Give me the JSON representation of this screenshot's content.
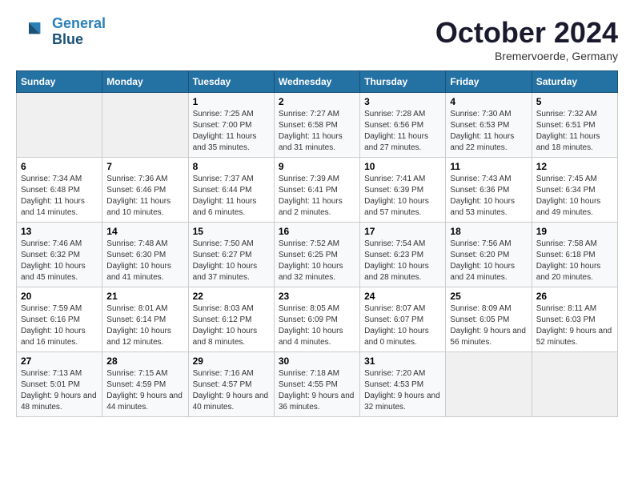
{
  "header": {
    "logo_line1": "General",
    "logo_line2": "Blue",
    "month": "October 2024",
    "location": "Bremervoerde, Germany"
  },
  "days_of_week": [
    "Sunday",
    "Monday",
    "Tuesday",
    "Wednesday",
    "Thursday",
    "Friday",
    "Saturday"
  ],
  "weeks": [
    [
      {
        "day": "",
        "sunrise": "",
        "sunset": "",
        "daylight": ""
      },
      {
        "day": "",
        "sunrise": "",
        "sunset": "",
        "daylight": ""
      },
      {
        "day": "1",
        "sunrise": "Sunrise: 7:25 AM",
        "sunset": "Sunset: 7:00 PM",
        "daylight": "Daylight: 11 hours and 35 minutes."
      },
      {
        "day": "2",
        "sunrise": "Sunrise: 7:27 AM",
        "sunset": "Sunset: 6:58 PM",
        "daylight": "Daylight: 11 hours and 31 minutes."
      },
      {
        "day": "3",
        "sunrise": "Sunrise: 7:28 AM",
        "sunset": "Sunset: 6:56 PM",
        "daylight": "Daylight: 11 hours and 27 minutes."
      },
      {
        "day": "4",
        "sunrise": "Sunrise: 7:30 AM",
        "sunset": "Sunset: 6:53 PM",
        "daylight": "Daylight: 11 hours and 22 minutes."
      },
      {
        "day": "5",
        "sunrise": "Sunrise: 7:32 AM",
        "sunset": "Sunset: 6:51 PM",
        "daylight": "Daylight: 11 hours and 18 minutes."
      }
    ],
    [
      {
        "day": "6",
        "sunrise": "Sunrise: 7:34 AM",
        "sunset": "Sunset: 6:48 PM",
        "daylight": "Daylight: 11 hours and 14 minutes."
      },
      {
        "day": "7",
        "sunrise": "Sunrise: 7:36 AM",
        "sunset": "Sunset: 6:46 PM",
        "daylight": "Daylight: 11 hours and 10 minutes."
      },
      {
        "day": "8",
        "sunrise": "Sunrise: 7:37 AM",
        "sunset": "Sunset: 6:44 PM",
        "daylight": "Daylight: 11 hours and 6 minutes."
      },
      {
        "day": "9",
        "sunrise": "Sunrise: 7:39 AM",
        "sunset": "Sunset: 6:41 PM",
        "daylight": "Daylight: 11 hours and 2 minutes."
      },
      {
        "day": "10",
        "sunrise": "Sunrise: 7:41 AM",
        "sunset": "Sunset: 6:39 PM",
        "daylight": "Daylight: 10 hours and 57 minutes."
      },
      {
        "day": "11",
        "sunrise": "Sunrise: 7:43 AM",
        "sunset": "Sunset: 6:36 PM",
        "daylight": "Daylight: 10 hours and 53 minutes."
      },
      {
        "day": "12",
        "sunrise": "Sunrise: 7:45 AM",
        "sunset": "Sunset: 6:34 PM",
        "daylight": "Daylight: 10 hours and 49 minutes."
      }
    ],
    [
      {
        "day": "13",
        "sunrise": "Sunrise: 7:46 AM",
        "sunset": "Sunset: 6:32 PM",
        "daylight": "Daylight: 10 hours and 45 minutes."
      },
      {
        "day": "14",
        "sunrise": "Sunrise: 7:48 AM",
        "sunset": "Sunset: 6:30 PM",
        "daylight": "Daylight: 10 hours and 41 minutes."
      },
      {
        "day": "15",
        "sunrise": "Sunrise: 7:50 AM",
        "sunset": "Sunset: 6:27 PM",
        "daylight": "Daylight: 10 hours and 37 minutes."
      },
      {
        "day": "16",
        "sunrise": "Sunrise: 7:52 AM",
        "sunset": "Sunset: 6:25 PM",
        "daylight": "Daylight: 10 hours and 32 minutes."
      },
      {
        "day": "17",
        "sunrise": "Sunrise: 7:54 AM",
        "sunset": "Sunset: 6:23 PM",
        "daylight": "Daylight: 10 hours and 28 minutes."
      },
      {
        "day": "18",
        "sunrise": "Sunrise: 7:56 AM",
        "sunset": "Sunset: 6:20 PM",
        "daylight": "Daylight: 10 hours and 24 minutes."
      },
      {
        "day": "19",
        "sunrise": "Sunrise: 7:58 AM",
        "sunset": "Sunset: 6:18 PM",
        "daylight": "Daylight: 10 hours and 20 minutes."
      }
    ],
    [
      {
        "day": "20",
        "sunrise": "Sunrise: 7:59 AM",
        "sunset": "Sunset: 6:16 PM",
        "daylight": "Daylight: 10 hours and 16 minutes."
      },
      {
        "day": "21",
        "sunrise": "Sunrise: 8:01 AM",
        "sunset": "Sunset: 6:14 PM",
        "daylight": "Daylight: 10 hours and 12 minutes."
      },
      {
        "day": "22",
        "sunrise": "Sunrise: 8:03 AM",
        "sunset": "Sunset: 6:12 PM",
        "daylight": "Daylight: 10 hours and 8 minutes."
      },
      {
        "day": "23",
        "sunrise": "Sunrise: 8:05 AM",
        "sunset": "Sunset: 6:09 PM",
        "daylight": "Daylight: 10 hours and 4 minutes."
      },
      {
        "day": "24",
        "sunrise": "Sunrise: 8:07 AM",
        "sunset": "Sunset: 6:07 PM",
        "daylight": "Daylight: 10 hours and 0 minutes."
      },
      {
        "day": "25",
        "sunrise": "Sunrise: 8:09 AM",
        "sunset": "Sunset: 6:05 PM",
        "daylight": "Daylight: 9 hours and 56 minutes."
      },
      {
        "day": "26",
        "sunrise": "Sunrise: 8:11 AM",
        "sunset": "Sunset: 6:03 PM",
        "daylight": "Daylight: 9 hours and 52 minutes."
      }
    ],
    [
      {
        "day": "27",
        "sunrise": "Sunrise: 7:13 AM",
        "sunset": "Sunset: 5:01 PM",
        "daylight": "Daylight: 9 hours and 48 minutes."
      },
      {
        "day": "28",
        "sunrise": "Sunrise: 7:15 AM",
        "sunset": "Sunset: 4:59 PM",
        "daylight": "Daylight: 9 hours and 44 minutes."
      },
      {
        "day": "29",
        "sunrise": "Sunrise: 7:16 AM",
        "sunset": "Sunset: 4:57 PM",
        "daylight": "Daylight: 9 hours and 40 minutes."
      },
      {
        "day": "30",
        "sunrise": "Sunrise: 7:18 AM",
        "sunset": "Sunset: 4:55 PM",
        "daylight": "Daylight: 9 hours and 36 minutes."
      },
      {
        "day": "31",
        "sunrise": "Sunrise: 7:20 AM",
        "sunset": "Sunset: 4:53 PM",
        "daylight": "Daylight: 9 hours and 32 minutes."
      },
      {
        "day": "",
        "sunrise": "",
        "sunset": "",
        "daylight": ""
      },
      {
        "day": "",
        "sunrise": "",
        "sunset": "",
        "daylight": ""
      }
    ]
  ]
}
